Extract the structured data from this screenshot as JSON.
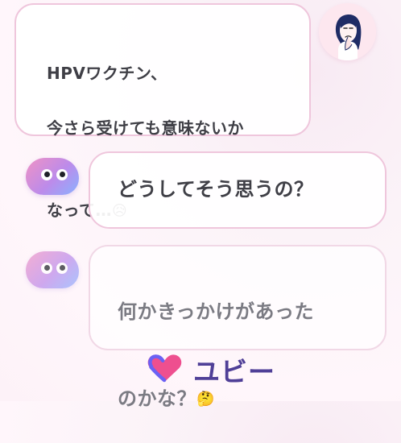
{
  "messages": {
    "user_line_1": "HPVワクチン、",
    "user_line_2": "今さら受けても意味ないか",
    "user_line_3": "なって…",
    "user_emoji": "😥",
    "bot_message_1": "どうしてそう思うの？",
    "bot_message_2_line_1": "何かきっかけがあった",
    "bot_message_2_line_2": "のかな？",
    "bot_emoji": "🤔"
  },
  "branding": {
    "name": "ユビー"
  },
  "icons": {
    "user_avatar": "worried-woman-icon",
    "bot_avatar": "blob-character-icon",
    "brand_logo": "heart-logo-icon"
  },
  "colors": {
    "brand_purple": "#4f3f97",
    "bubble_border_pink": "#efc6dc",
    "blob_pink": "#f092c4",
    "blob_blue": "#8ab1ff"
  }
}
